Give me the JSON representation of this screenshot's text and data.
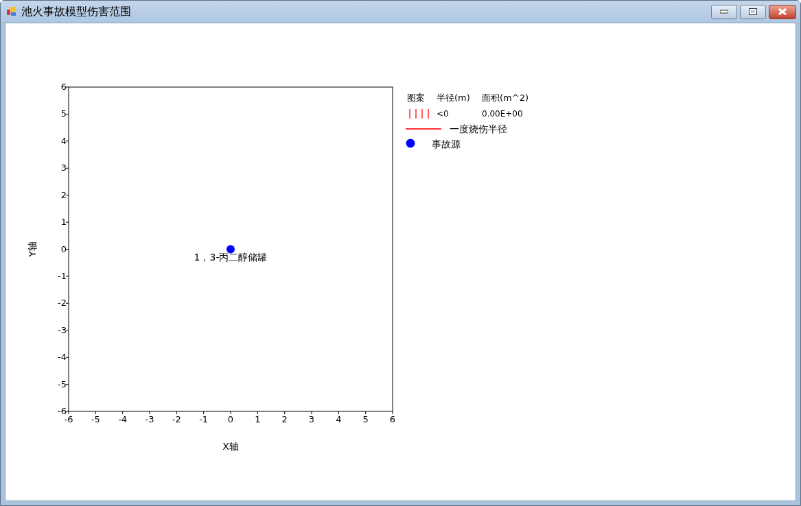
{
  "window": {
    "title": "池火事故模型伤害范围"
  },
  "chart": {
    "chart_data": {
      "type": "scatter",
      "xlabel": "X轴",
      "ylabel": "Y轴",
      "xlim": [
        -6,
        6
      ],
      "ylim": [
        -6,
        6
      ],
      "xticks": [
        {
          "value": -6,
          "label": "-6"
        },
        {
          "value": -5,
          "label": "-5"
        },
        {
          "value": -4,
          "label": "-4"
        },
        {
          "value": -3,
          "label": "-3"
        },
        {
          "value": -2,
          "label": "-2"
        },
        {
          "value": -1,
          "label": "-1"
        },
        {
          "value": 0,
          "label": "0"
        },
        {
          "value": 1,
          "label": "1"
        },
        {
          "value": 2,
          "label": "2"
        },
        {
          "value": 3,
          "label": "3"
        },
        {
          "value": 4,
          "label": "4"
        },
        {
          "value": 5,
          "label": "5"
        },
        {
          "value": 6,
          "label": "6"
        }
      ],
      "yticks": [
        {
          "value": -6,
          "label": "-6"
        },
        {
          "value": -5,
          "label": "-5"
        },
        {
          "value": -4,
          "label": "-4"
        },
        {
          "value": -3,
          "label": "-3"
        },
        {
          "value": -2,
          "label": "-2"
        },
        {
          "value": -1,
          "label": "-1"
        },
        {
          "value": 0,
          "label": "0"
        },
        {
          "value": 1,
          "label": "1"
        },
        {
          "value": 2,
          "label": "2"
        },
        {
          "value": 3,
          "label": "3"
        },
        {
          "value": 4,
          "label": "4"
        },
        {
          "value": 5,
          "label": "5"
        },
        {
          "value": 6,
          "label": "6"
        }
      ],
      "series": [
        {
          "name": "事故源",
          "color": "#0000ff",
          "x": [
            0
          ],
          "values": [
            0
          ]
        }
      ],
      "annotations": [
        {
          "text": "1，3-丙二醇储罐",
          "x": 0,
          "y": 0
        }
      ]
    }
  },
  "legend": {
    "headers": [
      "图案",
      "半径(m)",
      "面积(m^2)"
    ],
    "rows": [
      {
        "kind": "hatch",
        "color": "#ff6060",
        "radius": "<0",
        "area": "0.00E+00"
      },
      {
        "kind": "line",
        "color": "#ff3030",
        "label": "一度烧伤半径"
      }
    ]
  }
}
